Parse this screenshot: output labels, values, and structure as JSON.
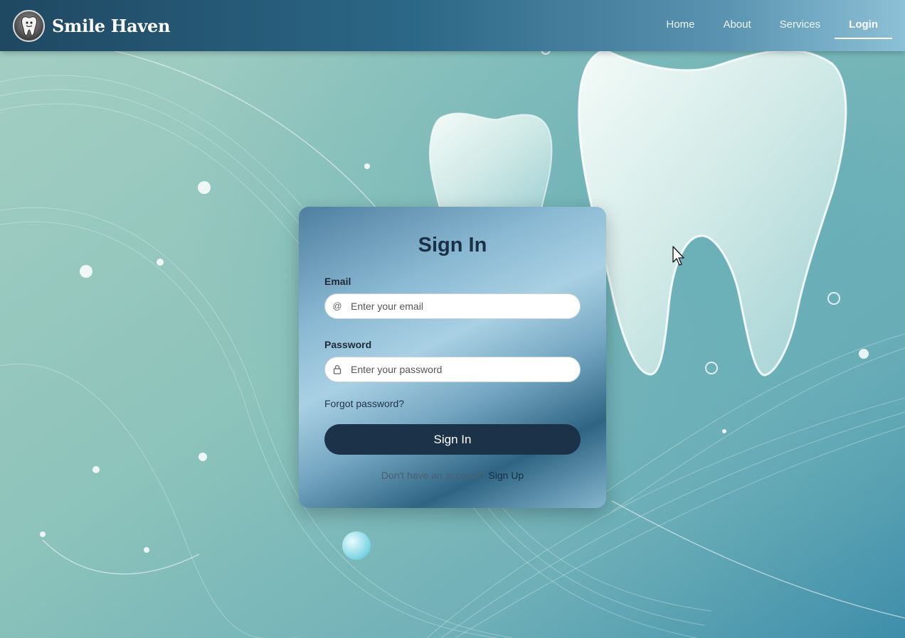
{
  "brand": {
    "name": "Smile Haven",
    "logo_icon": "tooth-logo-icon"
  },
  "nav": {
    "items": [
      {
        "label": "Home",
        "active": false
      },
      {
        "label": "About",
        "active": false
      },
      {
        "label": "Services",
        "active": false
      },
      {
        "label": "Login",
        "active": true
      }
    ]
  },
  "login": {
    "title": "Sign In",
    "email": {
      "label": "Email",
      "placeholder": "Enter your email",
      "icon": "at-icon"
    },
    "password": {
      "label": "Password",
      "placeholder": "Enter your password",
      "icon": "lock-icon"
    },
    "forgot_label": "Forgot password?",
    "submit_label": "Sign In",
    "signup_prompt": "Don't have an account?",
    "signup_link": "Sign Up"
  },
  "colors": {
    "nav_dark": "#1f4862",
    "button": "#1c3249",
    "title": "#1b2f45",
    "background_teal": "#8fc4bd"
  }
}
